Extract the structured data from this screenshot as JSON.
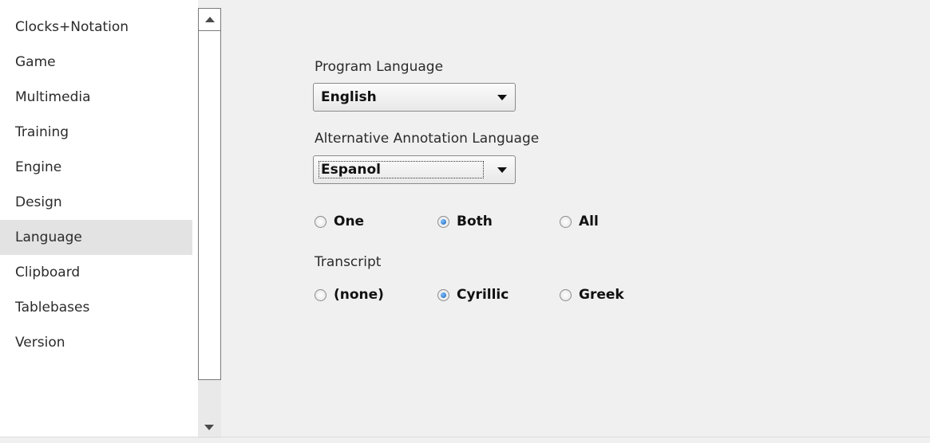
{
  "sidebar": {
    "items": [
      {
        "label": "Clocks+Notation"
      },
      {
        "label": "Game"
      },
      {
        "label": "Multimedia"
      },
      {
        "label": "Training"
      },
      {
        "label": "Engine"
      },
      {
        "label": "Design"
      },
      {
        "label": "Language",
        "selected": true
      },
      {
        "label": "Clipboard"
      },
      {
        "label": "Tablebases"
      },
      {
        "label": "Version"
      }
    ]
  },
  "scrollbar": {
    "up_icon": "arrow-up-icon",
    "down_icon": "arrow-down-icon"
  },
  "main": {
    "program_language": {
      "label": "Program Language",
      "value": "English"
    },
    "annotation_language": {
      "label": "Alternative Annotation Language",
      "value": "Espanol"
    },
    "annotation_mode": {
      "options": [
        {
          "label": "One",
          "checked": false
        },
        {
          "label": "Both",
          "checked": true
        },
        {
          "label": "All",
          "checked": false
        }
      ]
    },
    "transcript": {
      "label": "Transcript",
      "options": [
        {
          "label": "(none)",
          "checked": false
        },
        {
          "label": "Cyrillic",
          "checked": true
        },
        {
          "label": "Greek",
          "checked": false
        }
      ]
    }
  },
  "colors": {
    "selected_bg": "#e3e3e3",
    "panel_bg": "#f0f0f0",
    "radio_accent": "#1a5fb4"
  }
}
